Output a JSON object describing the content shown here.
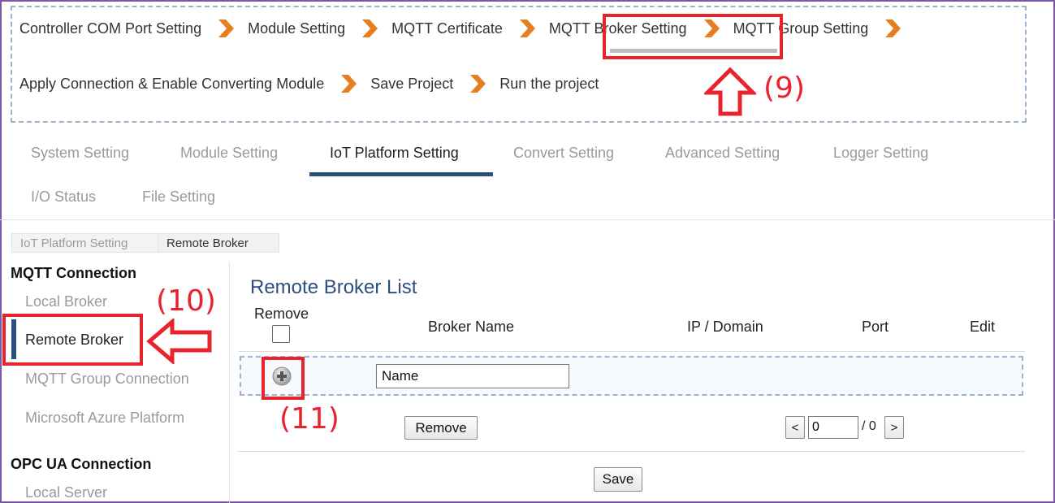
{
  "wizard": {
    "steps_row1": [
      "Controller COM Port Setting",
      "Module Setting",
      "MQTT Certificate",
      "MQTT Broker Setting",
      "MQTT Group Setting"
    ],
    "steps_row2": [
      "Apply Connection & Enable Converting Module",
      "Save Project",
      "Run the project"
    ],
    "active_step": "MQTT Broker Setting",
    "arrow_color": "#e67e22"
  },
  "callouts": {
    "c9": "(9)",
    "c10": "(10)",
    "c11": "(11)"
  },
  "tabs": {
    "items": [
      "System Setting",
      "Module Setting",
      "IoT Platform Setting",
      "Convert Setting",
      "Advanced Setting",
      "Logger Setting",
      "I/O Status",
      "File Setting"
    ],
    "active": "IoT Platform Setting"
  },
  "breadcrumb": [
    "IoT Platform Setting",
    "Remote Broker"
  ],
  "sidebar": {
    "groups": [
      {
        "title": "MQTT Connection",
        "items": [
          "Local Broker",
          "Remote Broker",
          "MQTT Group Connection",
          "Microsoft Azure Platform"
        ]
      },
      {
        "title": "OPC UA Connection",
        "items": [
          "Local Server"
        ]
      }
    ],
    "active": "Remote Broker"
  },
  "panel": {
    "title": "Remote Broker List",
    "columns": {
      "remove": "Remove",
      "broker_name": "Broker Name",
      "ip_domain": "IP / Domain",
      "port": "Port",
      "edit": "Edit"
    },
    "name_input_value": "Name",
    "remove_button": "Remove",
    "pager": {
      "prev": "<",
      "current": "0",
      "total": "/ 0",
      "next": ">"
    },
    "save_button": "Save"
  },
  "colors": {
    "accent": "#2c4f7e",
    "highlight": "#e8232d"
  }
}
